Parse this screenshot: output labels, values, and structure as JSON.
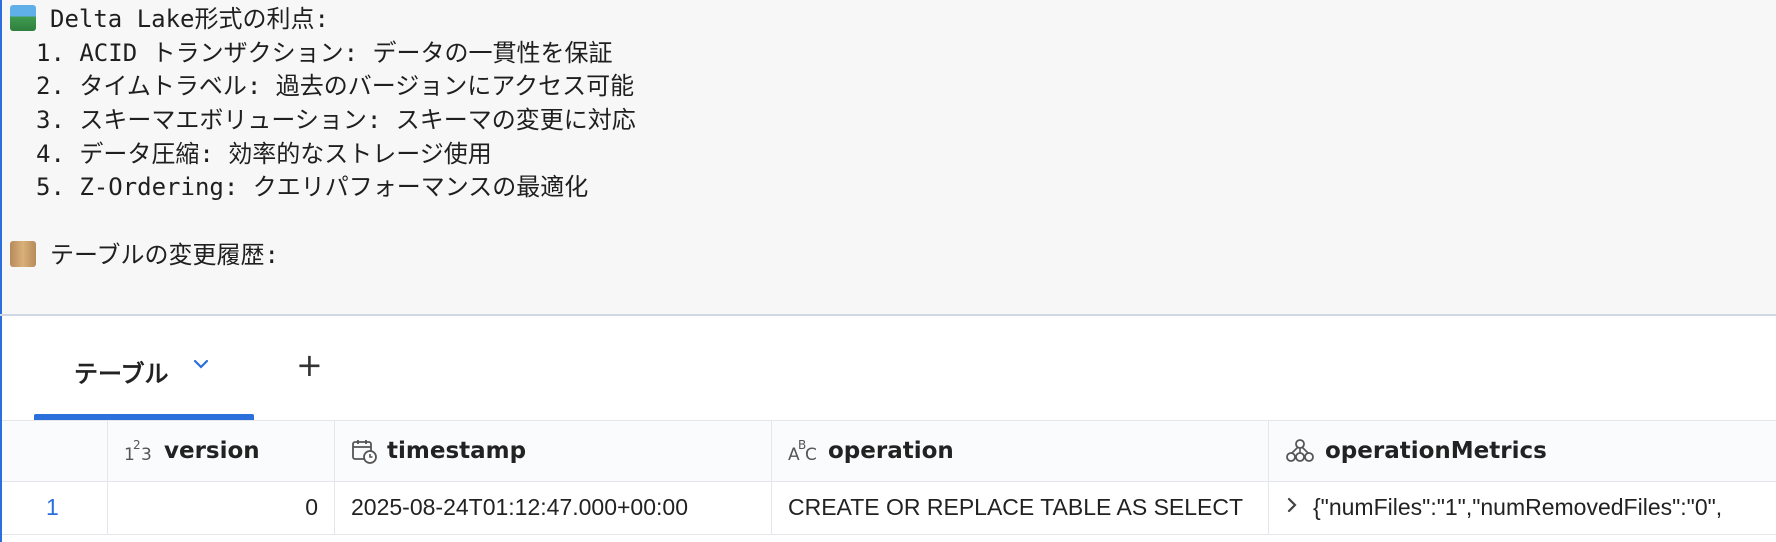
{
  "output": {
    "benefits_title": "Delta Lake形式の利点:",
    "benefits": [
      "1. ACID トランザクション: データの一貫性を保証",
      "2. タイムトラベル: 過去のバージョンにアクセス可能",
      "3. スキーマエボリューション: スキーマの変更に対応",
      "4. データ圧縮: 効率的なストレージ使用",
      "5. Z-Ordering: クエリパフォーマンスの最適化"
    ],
    "history_title": "テーブルの変更履歴:"
  },
  "result": {
    "tab_label": "テーブル",
    "add_tab_symbol": "+",
    "columns": [
      {
        "name": "version",
        "icon": "integer-type-icon",
        "icon_text": "1²3"
      },
      {
        "name": "timestamp",
        "icon": "calendar-clock-icon"
      },
      {
        "name": "operation",
        "icon": "string-type-icon",
        "icon_text": "AᴮC"
      },
      {
        "name": "operationMetrics",
        "icon": "struct-type-icon"
      }
    ],
    "rows": [
      {
        "index": "1",
        "version": "0",
        "timestamp": "2025-08-24T01:12:47.000+00:00",
        "operation": "CREATE OR REPLACE TABLE AS SELECT",
        "operationMetrics": "{\"numFiles\":\"1\",\"numRemovedFiles\":\"0\","
      }
    ]
  },
  "colors": {
    "accent": "#2a6fdb",
    "output_background": "#f7f7f7",
    "grid_border": "#e4e6ea"
  }
}
